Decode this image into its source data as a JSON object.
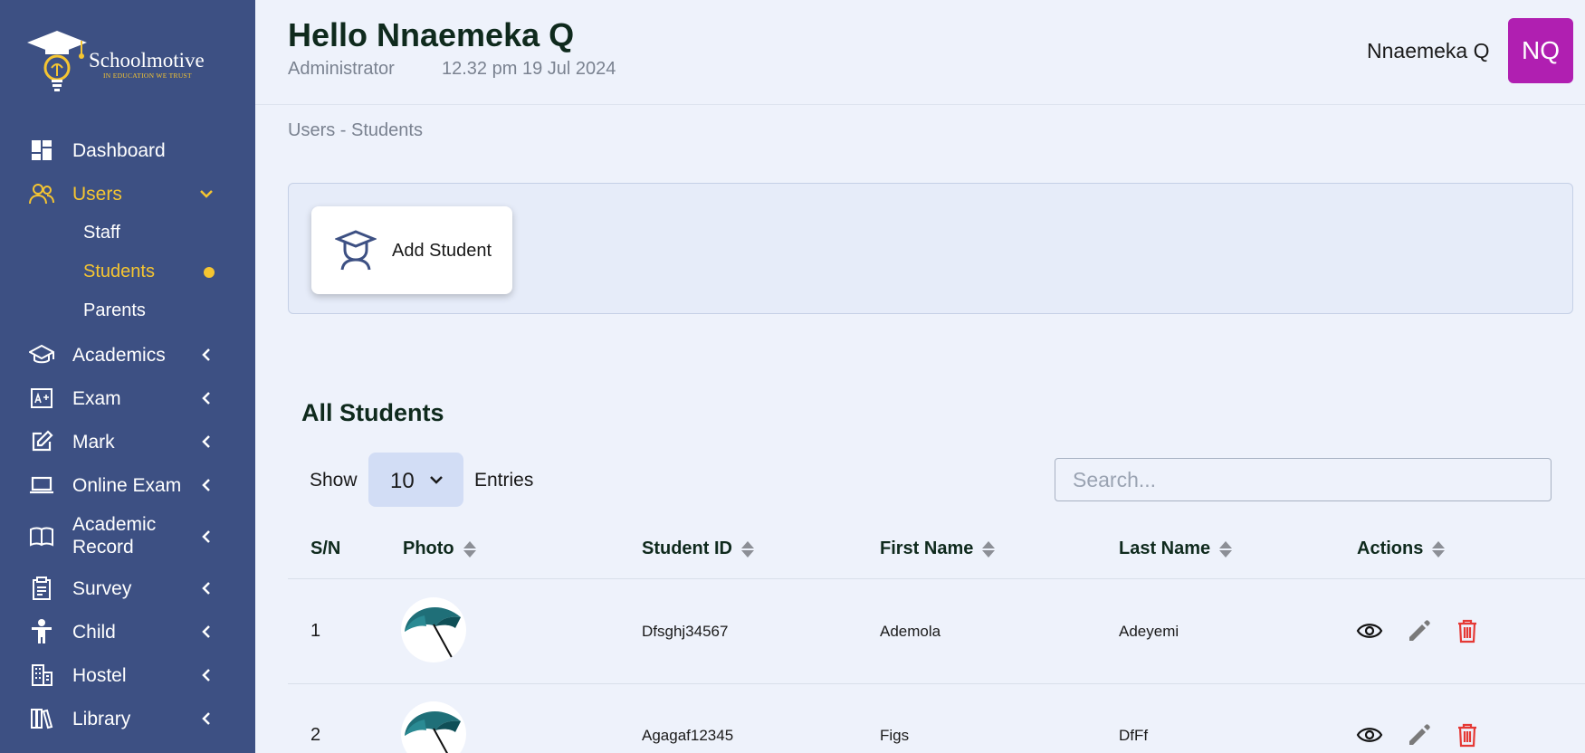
{
  "sidebar": {
    "brand": {
      "name": "Schoolmotive",
      "tagline": "IN EDUCATION WE TRUST"
    },
    "items": [
      {
        "label": "Dashboard",
        "icon": "dashboard-icon"
      },
      {
        "label": "Users",
        "icon": "users-icon",
        "active": true,
        "expanded": true,
        "children": [
          {
            "label": "Staff"
          },
          {
            "label": "Students",
            "active": true
          },
          {
            "label": "Parents"
          }
        ]
      },
      {
        "label": "Academics",
        "icon": "graduation-cap-icon"
      },
      {
        "label": "Exam",
        "icon": "exam-icon"
      },
      {
        "label": "Mark",
        "icon": "edit-icon"
      },
      {
        "label": "Online Exam",
        "icon": "laptop-icon"
      },
      {
        "label": "Academic Record",
        "icon": "book-icon"
      },
      {
        "label": "Survey",
        "icon": "clipboard-icon"
      },
      {
        "label": "Child",
        "icon": "child-icon"
      },
      {
        "label": "Hostel",
        "icon": "building-icon"
      },
      {
        "label": "Library",
        "icon": "library-icon"
      }
    ]
  },
  "header": {
    "greeting": "Hello Nnaemeka Q",
    "role": "Administrator",
    "timestamp": "12.32 pm 19 Jul 2024",
    "user_name": "Nnaemeka Q",
    "avatar_initials": "NQ",
    "avatar_color": "#b01fb1"
  },
  "breadcrumb": "Users - Students",
  "actions": {
    "add_student": "Add Student"
  },
  "table_section": {
    "title": "All Students",
    "show_label": "Show",
    "entries_value": "10",
    "entries_label": "Entries",
    "search_placeholder": "Search...",
    "columns": [
      "S/N",
      "Photo",
      "Student ID",
      "First Name",
      "Last Name",
      "Actions"
    ],
    "rows": [
      {
        "sn": "1",
        "photo": "umbrella-photo",
        "student_id": "Dfsghj34567",
        "first_name": "Ademola",
        "last_name": "Adeyemi"
      },
      {
        "sn": "2",
        "photo": "umbrella-photo",
        "student_id": "Agagaf12345",
        "first_name": "Figs",
        "last_name": "DfFf"
      }
    ],
    "row_actions": [
      "view-icon",
      "edit-icon",
      "delete-icon"
    ]
  },
  "colors": {
    "sidebar_bg": "#3d5083",
    "accent": "#f5c531",
    "page_bg": "#eef2fb",
    "delete": "#e53935"
  }
}
